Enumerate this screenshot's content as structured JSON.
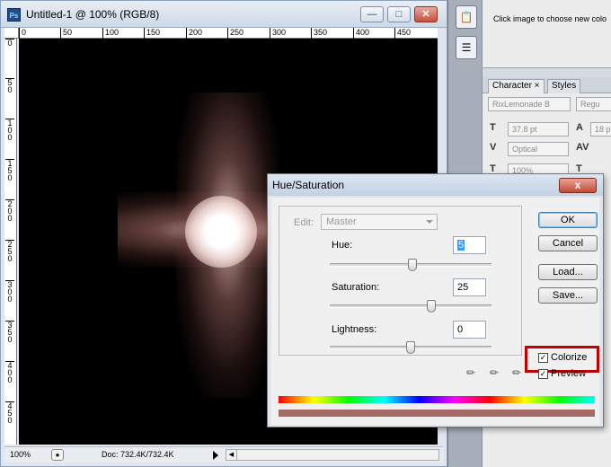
{
  "document": {
    "title": "Untitled-1 @ 100% (RGB/8)",
    "app_icon": "Ps",
    "ruler_top": [
      "0",
      "50",
      "100",
      "150",
      "200",
      "250",
      "300",
      "350",
      "400",
      "450"
    ],
    "ruler_left": [
      "0",
      "5 0",
      "1 0 0",
      "1 5 0",
      "2 0 0",
      "2 5 0",
      "3 0 0",
      "3 5 0",
      "4 0 0",
      "4 5 0"
    ],
    "status": {
      "zoom": "100%",
      "doc_info": "Doc: 732.4K/732.4K"
    }
  },
  "info_panel": {
    "hint": "Click image to choose new colo"
  },
  "character_panel": {
    "tabs": [
      "Character",
      "Styles"
    ],
    "font_family": "RixLemonade B",
    "font_style": "Regu",
    "font_size": "37.8 pt",
    "leading": "18 p",
    "kerning": "Optical",
    "horizontal_scale": "100%",
    "vertical_scale": "100%"
  },
  "dialog": {
    "title": "Hue/Saturation",
    "close_symbol": "x",
    "edit_label": "Edit:",
    "edit_value": "Master",
    "hue": {
      "label": "Hue:",
      "value": "5",
      "level": 0.51
    },
    "saturation": {
      "label": "Saturation:",
      "value": "25",
      "level": 0.625
    },
    "lightness": {
      "label": "Lightness:",
      "value": "0",
      "level": 0.5
    },
    "buttons": {
      "ok": "OK",
      "cancel": "Cancel",
      "load": "Load...",
      "save": "Save..."
    },
    "colorize": {
      "label": "Colorize",
      "checked": true
    },
    "preview": {
      "label": "Preview",
      "checked": true
    },
    "colorize_color": "#a36a66",
    "highlight_color": "#c00000"
  }
}
